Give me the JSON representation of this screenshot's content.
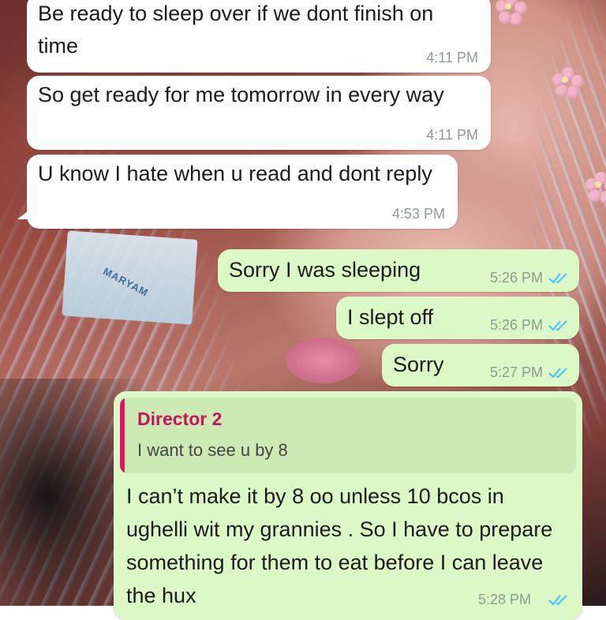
{
  "conversation": {
    "messages": [
      {
        "direction": "incoming",
        "text": "Be ready to sleep over if we dont finish on time",
        "time": "4:11 PM"
      },
      {
        "direction": "incoming",
        "text": "So get ready for me tomorrow in every way",
        "time": "4:11 PM"
      },
      {
        "direction": "incoming",
        "text": "U know I hate when u read and dont reply",
        "time": "4:53 PM"
      },
      {
        "direction": "outgoing",
        "text": "Sorry I was sleeping",
        "time": "5:26 PM",
        "status": "read"
      },
      {
        "direction": "outgoing",
        "text": "I slept off",
        "time": "5:26 PM",
        "status": "read"
      },
      {
        "direction": "outgoing",
        "text": "Sorry",
        "time": "5:27 PM",
        "status": "read"
      },
      {
        "direction": "outgoing",
        "reply_to": {
          "author": "Director 2",
          "text": "I want to see u by 8"
        },
        "text": "I can’t make it by 8 oo unless 10 bcos in ughelli wit my grannies . So I have to prepare something for them to eat before I can leave the hux",
        "time": "5:28 PM",
        "status": "read"
      }
    ]
  },
  "background": {
    "sticker_text": "MARYAM"
  },
  "colors": {
    "incoming_bubble": "#ffffff",
    "outgoing_bubble": "#dcf8c6",
    "quote_accent": "#d81b60",
    "read_ticks": "#4fc3f7"
  }
}
